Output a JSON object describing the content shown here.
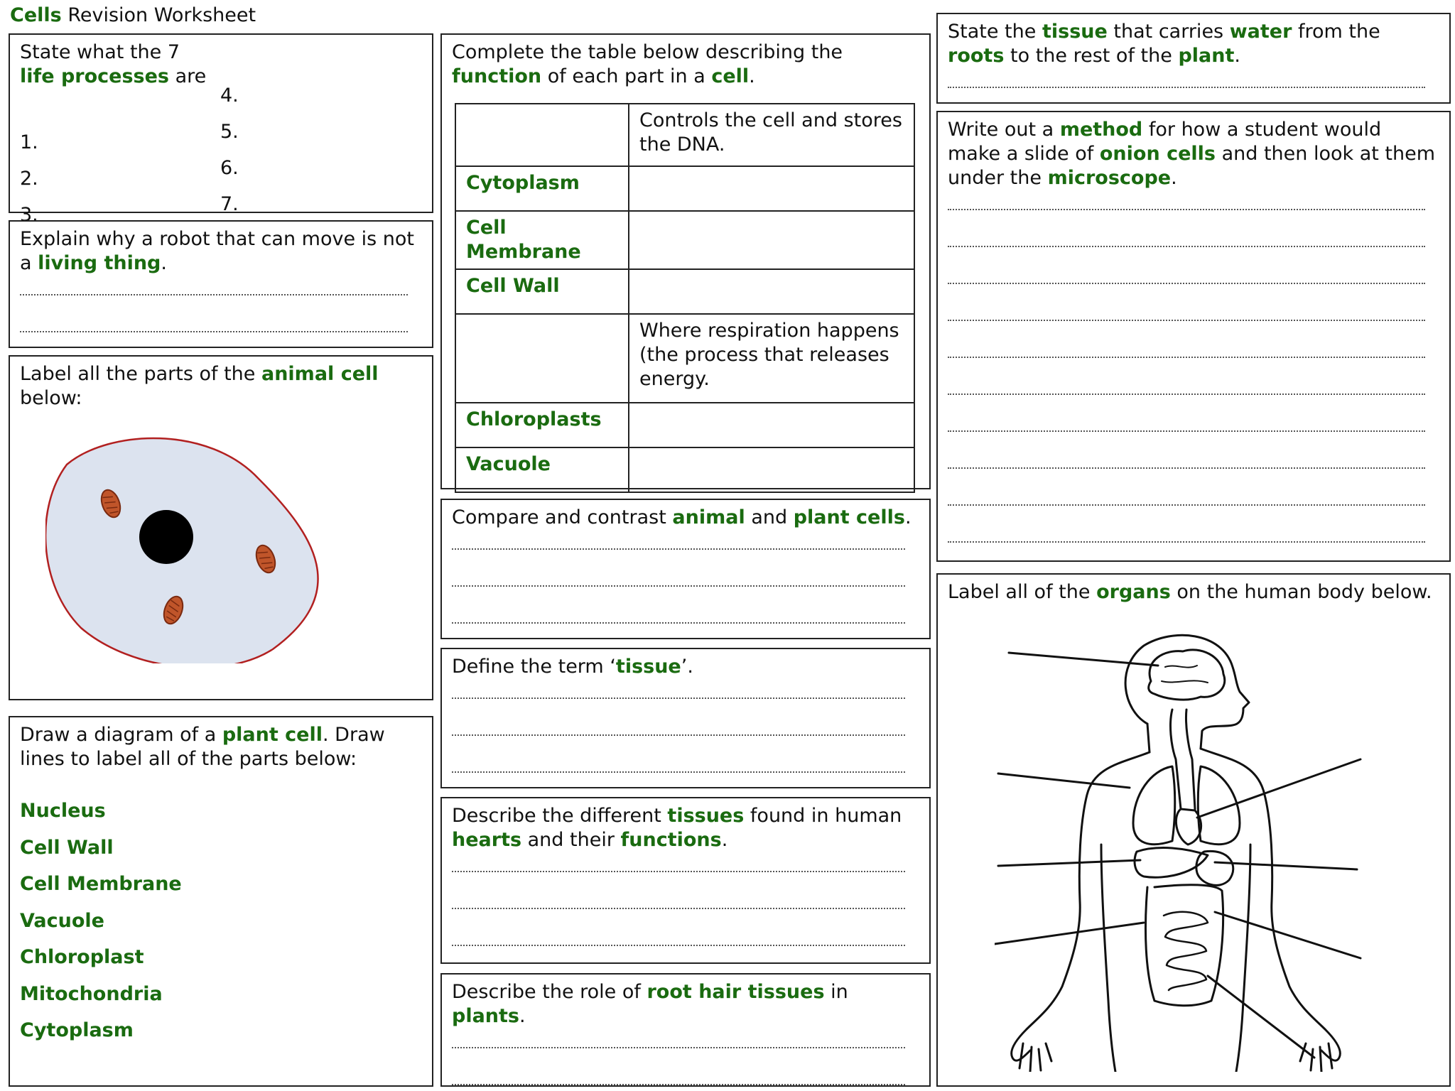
{
  "title": {
    "bold": "Cells",
    "rest": "Revision Worksheet"
  },
  "life_processes": {
    "q_a": "State what the 7",
    "q_g": "life processes",
    "q_b": "are",
    "left_numbers": [
      "1.",
      "2.",
      "3."
    ],
    "right_numbers": [
      "4.",
      "5.",
      "6.",
      "7."
    ]
  },
  "robot": {
    "q_a": "Explain why a robot that can move is not a",
    "q_g": "living thing",
    "q_b": "."
  },
  "animal_cell": {
    "q_a": "Label all the parts of the",
    "q_g": "animal cell",
    "q_b": "below:"
  },
  "plant_cell": {
    "q_a": "Draw a diagram of a",
    "q_g": "plant cell",
    "q_b": ". Draw lines to label all of the parts below:",
    "parts": [
      "Nucleus",
      "Cell Wall",
      "Cell Membrane",
      "Vacuole",
      "Chloroplast",
      "Mitochondria",
      "Cytoplasm"
    ]
  },
  "function_table": {
    "q_a": "Complete the table below describing the",
    "q_g1": "function",
    "q_b": "of each part in a",
    "q_g2": "cell",
    "q_c": ".",
    "rows": [
      {
        "part": "",
        "function": "Controls the cell and stores the DNA."
      },
      {
        "part": "Cytoplasm",
        "function": ""
      },
      {
        "part": "Cell Membrane",
        "function": ""
      },
      {
        "part": "Cell Wall",
        "function": ""
      },
      {
        "part": "",
        "function": "Where respiration happens (the process that releases energy."
      },
      {
        "part": "Chloroplasts",
        "function": ""
      },
      {
        "part": "Vacuole",
        "function": ""
      }
    ]
  },
  "compare": {
    "q_a": "Compare and contrast",
    "q_g1": "animal",
    "q_b": "and",
    "q_g2": "plant cells",
    "q_c": "."
  },
  "define": {
    "q_a": "Define the term ‘",
    "q_g": "tissue",
    "q_b": "’."
  },
  "hearts": {
    "q_a": "Describe the different",
    "q_g1": "tissues",
    "q_b": "found in human",
    "q_g2": "hearts",
    "q_c": "and their",
    "q_g3": "functions",
    "q_d": "."
  },
  "root_hair": {
    "q_a": "Describe the role of",
    "q_g1": "root hair tissues",
    "q_b": "in",
    "q_g2": "plants",
    "q_c": "."
  },
  "xylem": {
    "q_a": "State the",
    "q_g1": "tissue",
    "q_b": "that carries",
    "q_g2": "water",
    "q_c": "from the",
    "q_g3": "roots",
    "q_d": "to the rest of the",
    "q_g4": "plant",
    "q_e": "."
  },
  "method": {
    "q_a": "Write out a",
    "q_g1": "method",
    "q_b": "for how a student would make a slide of",
    "q_g2": "onion cells",
    "q_c": "and then look at them under the",
    "q_g3": "microscope",
    "q_d": "."
  },
  "organs": {
    "q_a": "Label all of the",
    "q_g": "organs",
    "q_b": "on the human body below."
  }
}
